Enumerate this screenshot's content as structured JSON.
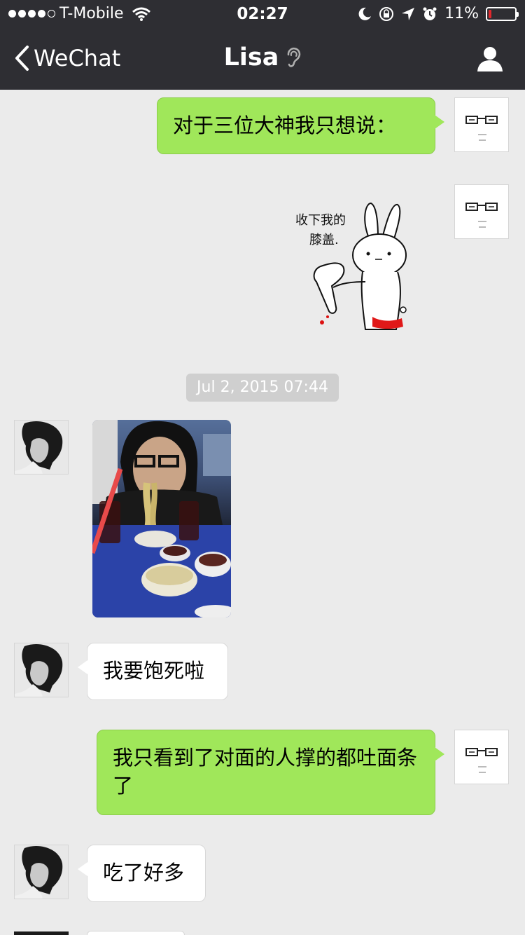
{
  "status": {
    "carrier": "T-Mobile",
    "time": "02:27",
    "battery": "11%",
    "battery_level": 0.11,
    "signal_bars": 4
  },
  "nav": {
    "back_label": "WeChat",
    "title": "Lisa"
  },
  "colors": {
    "header_bg": "#2e2e33",
    "chat_bg": "#ebebeb",
    "sent_bubble": "#a0e75a",
    "received_bubble": "#ffffff",
    "battery_low": "#e0282d"
  },
  "icons": {
    "back": "chevron-left-icon",
    "earpiece": "ear-icon",
    "profile": "person-icon"
  },
  "sticker": {
    "text_line1": "收下我的",
    "text_line2": "膝盖."
  },
  "messages": [
    {
      "from": "me",
      "type": "text",
      "text": "对于三位大神我只想说："
    },
    {
      "from": "me",
      "type": "sticker"
    },
    {
      "type": "timestamp",
      "text": "Jul 2, 2015 07:44"
    },
    {
      "from": "Lisa",
      "type": "image"
    },
    {
      "from": "Lisa",
      "type": "text",
      "text": "我要饱死啦"
    },
    {
      "from": "me",
      "type": "text",
      "text": "我只看到了对面的人撑的都吐面条了"
    },
    {
      "from": "Lisa",
      "type": "text",
      "text": "吃了好多"
    }
  ]
}
